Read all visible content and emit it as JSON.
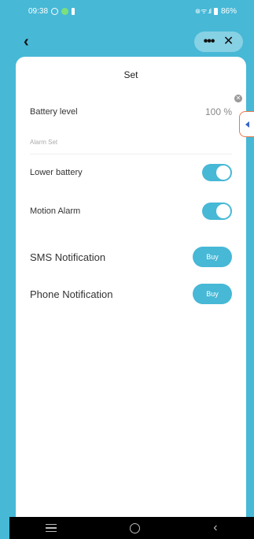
{
  "status_bar": {
    "time": "09:38",
    "signal_text": "᪤ ᯤ .ıl",
    "battery": "86%"
  },
  "nav": {
    "back_icon": "chevron-left-icon",
    "more_icon": "more-icon",
    "close_icon": "close-icon"
  },
  "page": {
    "title": "Set",
    "battery_label": "Battery level",
    "battery_value": "100 %",
    "section_label": "Alarm Set",
    "toggles": [
      {
        "label": "Lower battery",
        "on": true
      },
      {
        "label": "Motion  Alarm",
        "on": true
      }
    ],
    "notifications": [
      {
        "label": "SMS Notification",
        "button": "Buy"
      },
      {
        "label": "Phone Notification",
        "button": "Buy"
      }
    ]
  },
  "colors": {
    "accent": "#47b8d6",
    "side_tab_border": "#e87a4a",
    "side_tab_arrow": "#3366cc"
  }
}
